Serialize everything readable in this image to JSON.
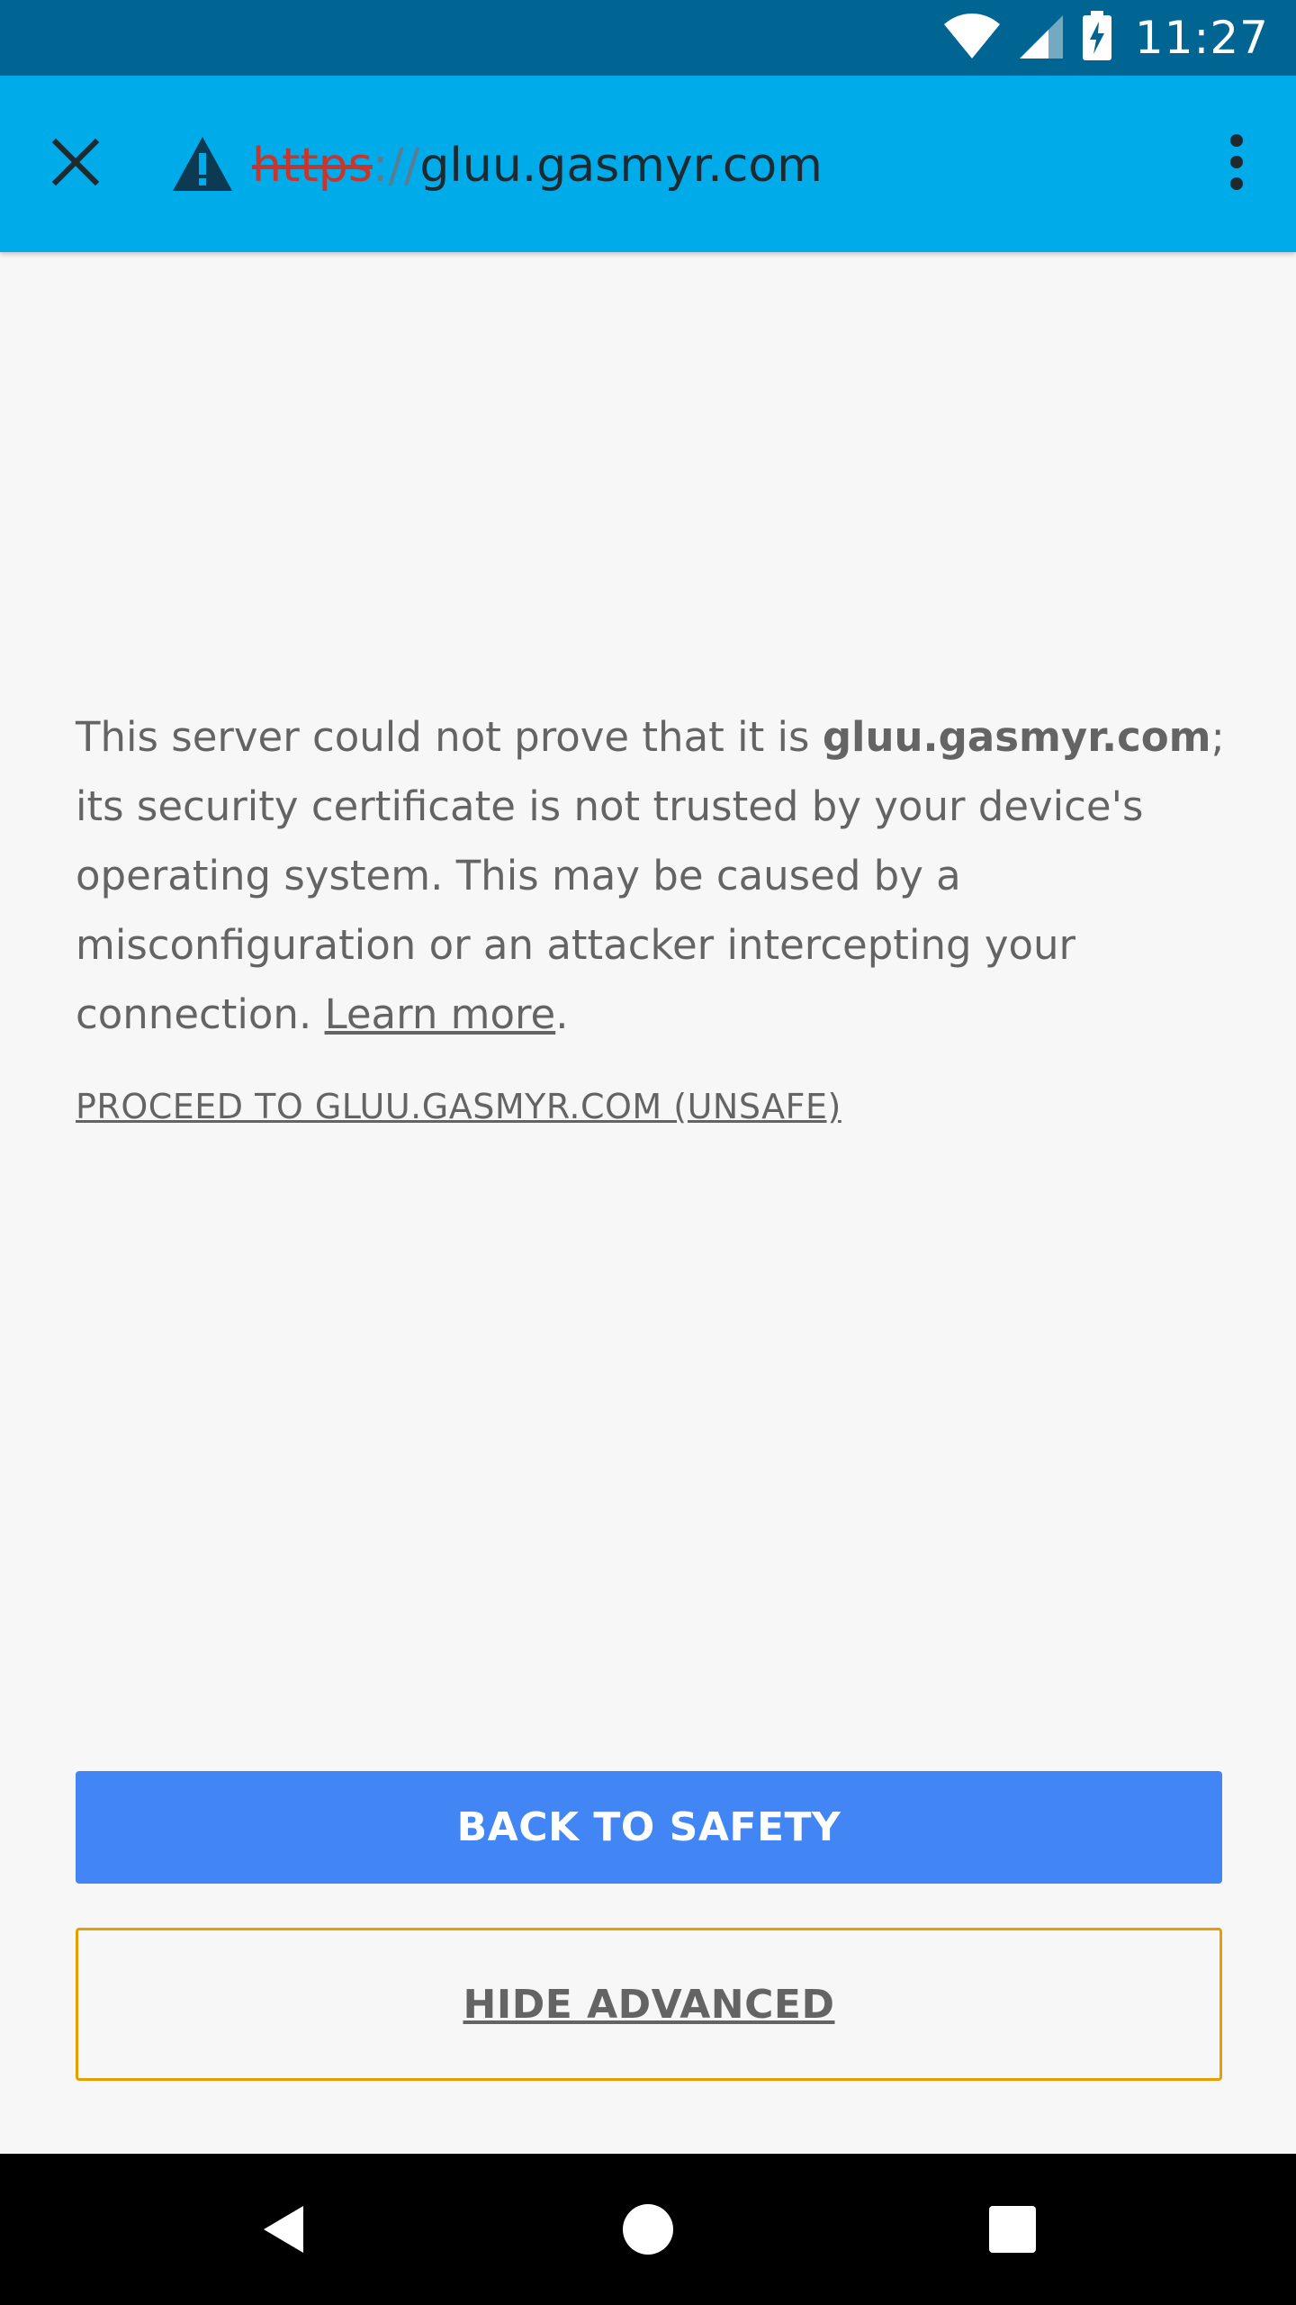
{
  "status_bar": {
    "time": "11:27",
    "icons": [
      "wifi-icon",
      "cell-signal-icon",
      "battery-charging-icon"
    ]
  },
  "toolbar": {
    "close_icon": "close-icon",
    "security_icon": "warning-icon",
    "url_scheme": "https",
    "url_separator": "://",
    "url_host": "gluu.gasmyr.com",
    "menu_icon": "more-vert-icon"
  },
  "content": {
    "text_part1": "This server could not prove that it is ",
    "host_bold": "gluu.gasmyr.com",
    "text_part2": "; its security certificate is not trusted by your device's operating system. This may be caused by a misconfiguration or an attacker intercepting your connection. ",
    "learn_more": "Learn more",
    "period": ".",
    "proceed_link": "PROCEED TO GLUU.GASMYR.COM (UNSAFE)"
  },
  "buttons": {
    "primary_label": "BACK TO SAFETY",
    "secondary_label": "HIDE ADVANCED"
  },
  "nav": {
    "back_icon": "back-icon",
    "home_icon": "home-icon",
    "recents_icon": "recents-icon"
  },
  "colors": {
    "status_bar": "#006592",
    "toolbar": "#00abea",
    "scheme_red": "#c9352b",
    "primary_button": "#4285f4",
    "focus_border": "#e69f00",
    "body_text": "#646464",
    "page_bg": "#f7f7f7"
  }
}
